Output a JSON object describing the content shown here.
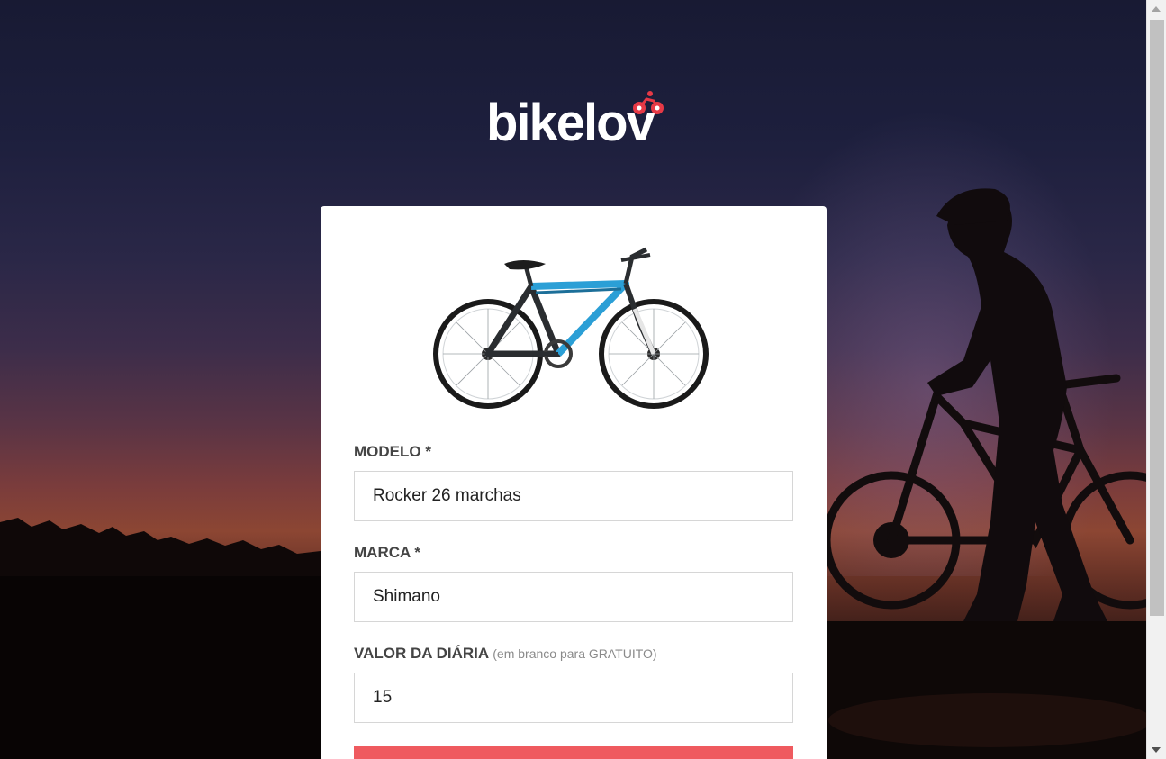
{
  "brand": {
    "logo_text": "bikelov",
    "logo_mark_icon": "cyclist-icon",
    "accent_color": "#e63946"
  },
  "form": {
    "image": {
      "icon": "mountain-bike-photo"
    },
    "fields": [
      {
        "label": "MODELO *",
        "hint": "",
        "value": "Rocker 26 marchas"
      },
      {
        "label": "MARCA *",
        "hint": "",
        "value": "Shimano"
      },
      {
        "label": "VALOR DA DIÁRIA",
        "hint": "(em branco para GRATUITO)",
        "value": "15"
      }
    ],
    "submit": {
      "label": "",
      "color": "#ef5a5f"
    }
  },
  "colors": {
    "card_background": "#ffffff",
    "label_color": "#444444",
    "hint_color": "#8a8a8a"
  }
}
